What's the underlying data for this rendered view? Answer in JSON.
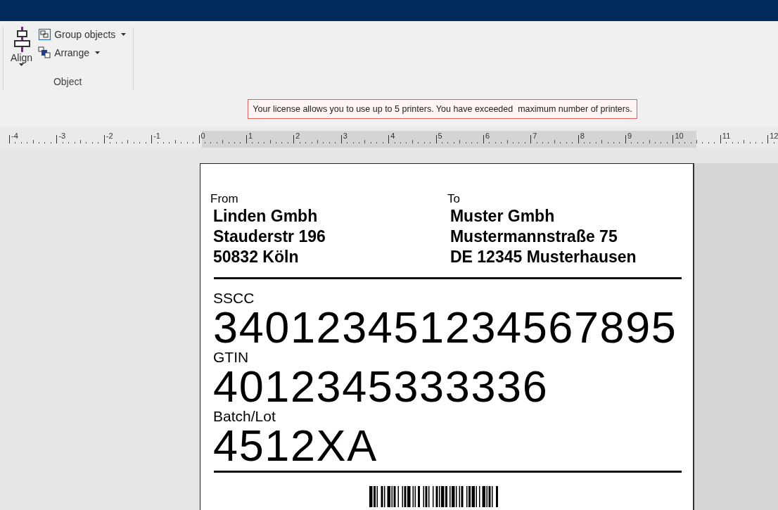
{
  "ribbon": {
    "groups": [
      {
        "label": "Object",
        "buttons": [
          {
            "kind": "large",
            "label": "Align",
            "dropdown": true
          },
          {
            "kind": "small",
            "label": "Group objects",
            "dropdown": true
          },
          {
            "kind": "small",
            "label": "Arrange",
            "dropdown": true
          }
        ]
      }
    ]
  },
  "notice": "Your license allows you to use up to 5 printers. You have exceeded  maximum number of printers.",
  "ruler": {
    "labels": [
      "-4",
      "-3",
      "-2",
      "-1",
      "0",
      "1",
      "2",
      "3",
      "4",
      "5",
      "6",
      "7",
      "8",
      "9",
      "10",
      "11",
      "12"
    ]
  },
  "label": {
    "from": {
      "heading": "From",
      "lines": [
        "Linden Gmbh",
        "Stauderstr 196",
        "50832 Köln"
      ]
    },
    "to": {
      "heading": "To",
      "lines": [
        "Muster Gmbh",
        "Mustermannstraße 75",
        "DE 12345 Musterhausen"
      ]
    },
    "fields": [
      {
        "caption": "SSCC",
        "value": "340123451234567895"
      },
      {
        "caption": "GTIN",
        "value": "4012345333336"
      },
      {
        "caption": "Batch/Lot",
        "value": "4512XA"
      }
    ]
  }
}
